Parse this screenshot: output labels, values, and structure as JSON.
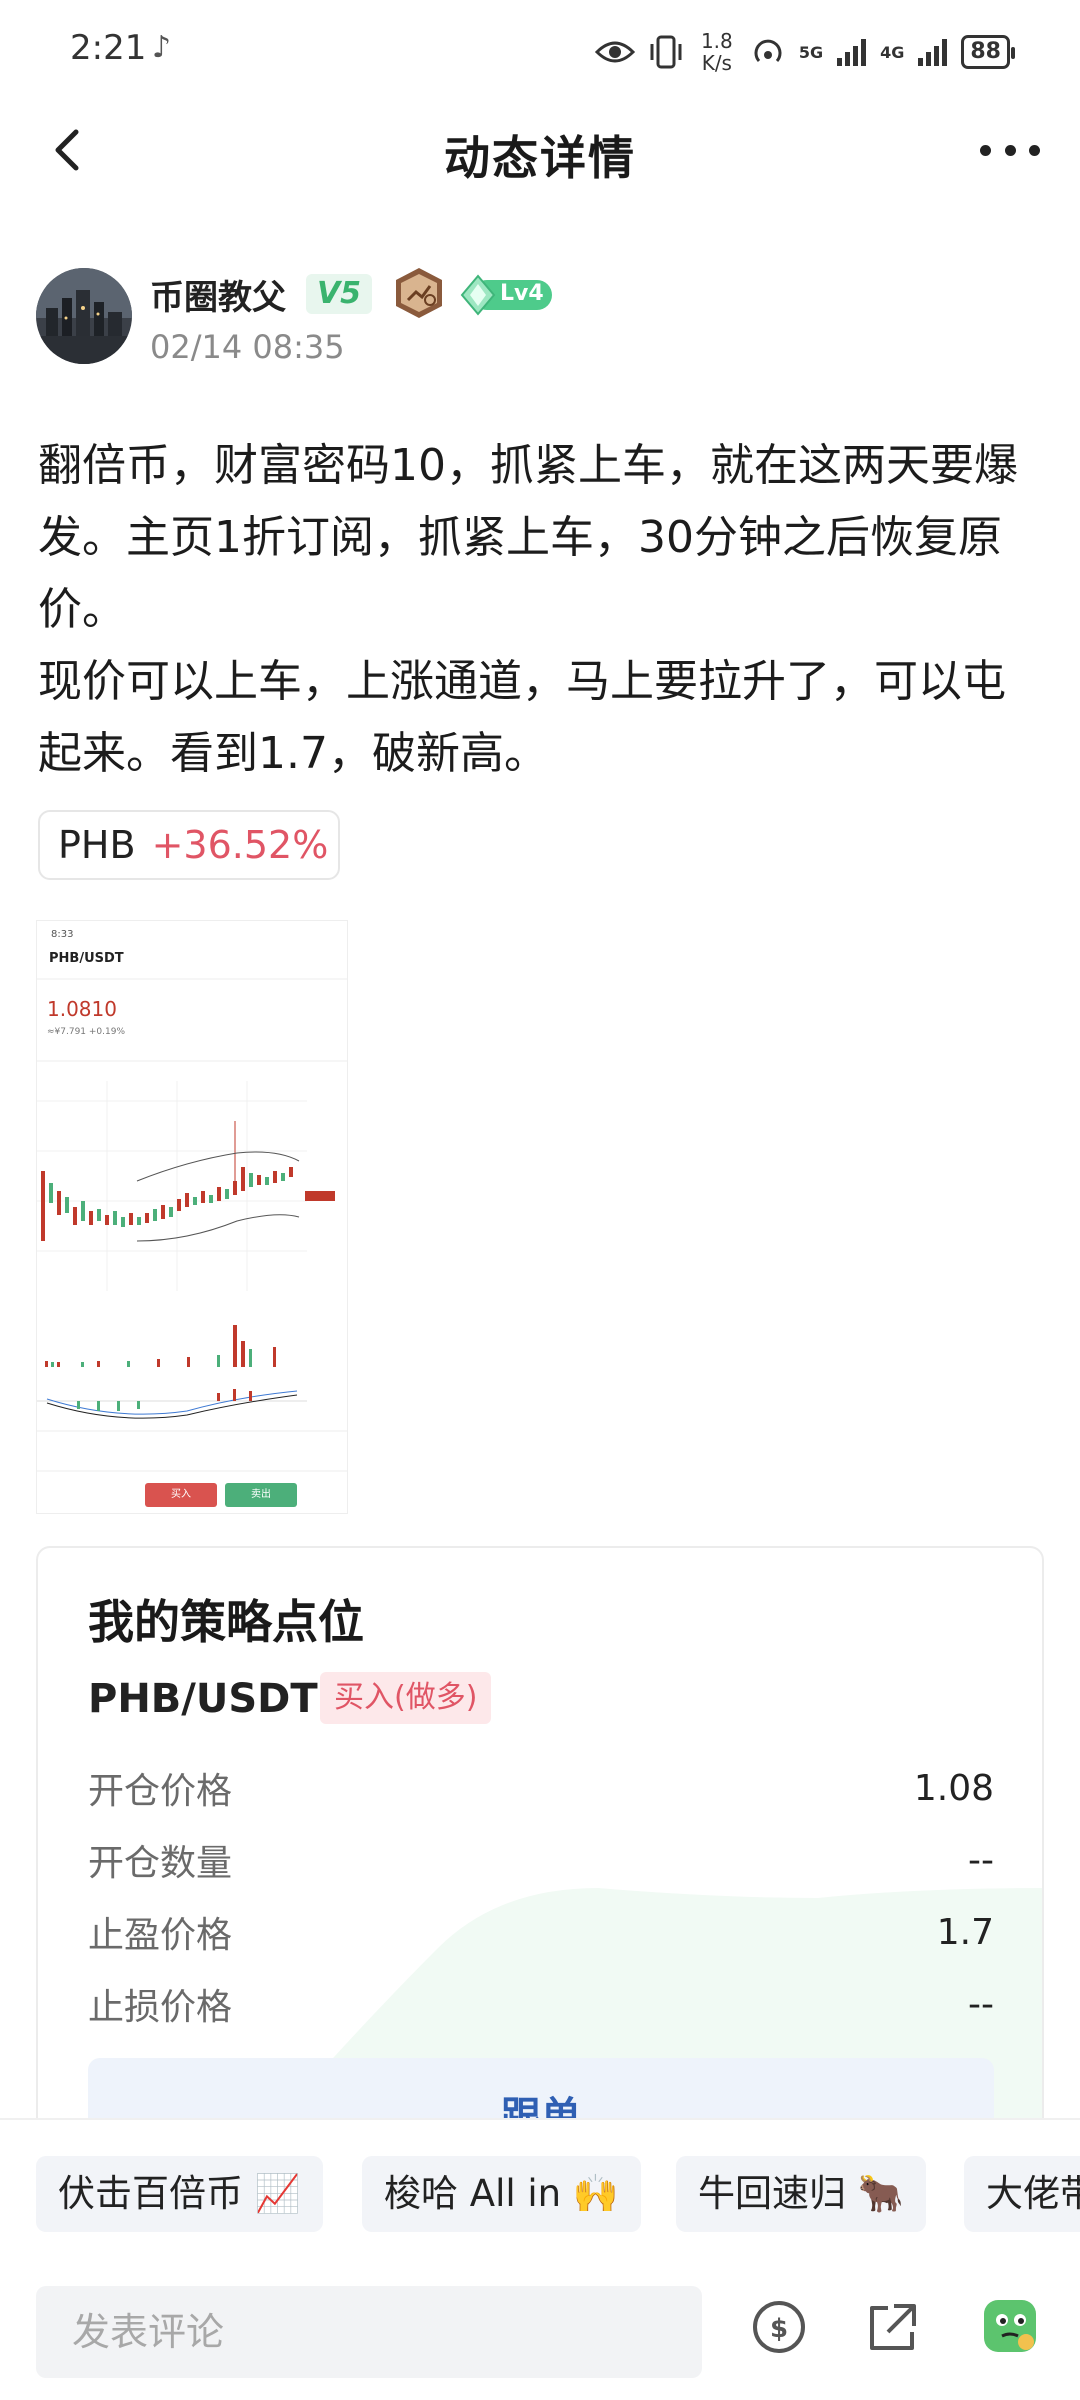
{
  "status_bar": {
    "time": "2:21",
    "note_icon": "music-note-icon",
    "speed_value": "1.8",
    "speed_unit": "K/s",
    "sim1": "5G",
    "sim2": "4G",
    "battery": "88"
  },
  "header": {
    "title": "动态详情",
    "back_icon": "chevron-left-icon",
    "more_icon": "more-dots-icon"
  },
  "author": {
    "name": "币圈教父",
    "vip": "V5",
    "level": "Lv4",
    "time": "02/14 08:35"
  },
  "post": {
    "lines": [
      "翻倍币，财富密码10，抓紧上车，就在这两天要爆发。主页1折订阅，抓紧上车，30分钟之后恢复原价。",
      "现价可以上车，上涨通道，马上要拉升了，可以屯起来。看到1.7，破新高。"
    ]
  },
  "coin_tag": {
    "symbol": "PHB",
    "change": "+36.52%",
    "change_color": "#e05565"
  },
  "thumbnail": {
    "status_time": "8:33",
    "pair": "PHB/USDT",
    "price": "1.0810",
    "sub": "≈¥7.791  +0.19%",
    "buy_label": "买入",
    "sell_label": "卖出"
  },
  "strategy": {
    "title": "我的策略点位",
    "pair": "PHB/USDT",
    "direction": "买入(做多)",
    "rows": [
      {
        "label": "开仓价格",
        "value": "1.08"
      },
      {
        "label": "开仓数量",
        "value": "--"
      },
      {
        "label": "止盈价格",
        "value": "1.7"
      },
      {
        "label": "止损价格",
        "value": "--"
      }
    ],
    "follow_label": "跟单"
  },
  "chips": [
    {
      "label": "伏击百倍币 📈"
    },
    {
      "label": "梭哈 All in 🙌"
    },
    {
      "label": "牛回速归 🐂"
    },
    {
      "label": "大佬带"
    }
  ],
  "comment": {
    "placeholder": "发表评论"
  },
  "colors": {
    "up": "#e05565",
    "follow_blue": "#2f5fb3"
  }
}
